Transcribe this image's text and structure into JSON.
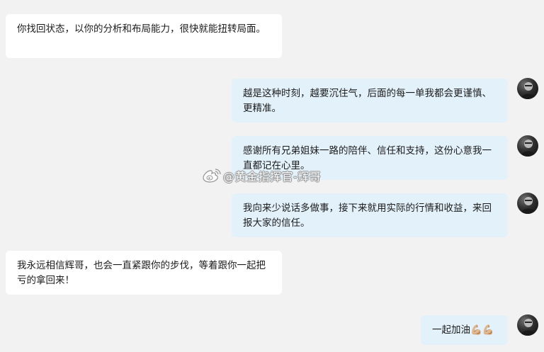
{
  "conversation": {
    "messages": [
      {
        "side": "left",
        "text": "你找回状态，以你的分析和布局能力，很快就能扭转局面。"
      },
      {
        "side": "right",
        "text": "越是这种时刻，越要沉住气，后面的每一单我都会更谨慎、更精准。",
        "avatar_icon": "user-avatar"
      },
      {
        "side": "right",
        "text": "感谢所有兄弟姐妹一路的陪伴、信任和支持，这份心意我一直都记在心里。",
        "avatar_icon": "user-avatar"
      },
      {
        "side": "right",
        "text": "我向来少说话多做事，接下来就用实际的行情和收益，来回报大家的信任。",
        "avatar_icon": "user-avatar"
      },
      {
        "side": "left",
        "text": "我永远相信辉哥，也会一直紧跟你的步伐，等着跟你一起把亏的拿回来！"
      },
      {
        "side": "right",
        "text": "一起加油💪🏼💪🏼",
        "avatar_icon": "user-avatar"
      }
    ]
  },
  "watermark": {
    "text": "@黄金指挥官-辉哥",
    "icon": "weibo-logo-icon"
  },
  "colors": {
    "background": "#f2f2f2",
    "incoming_bubble": "#ffffff",
    "outgoing_bubble": "#e3f1fb",
    "text": "#1c1c1c"
  }
}
